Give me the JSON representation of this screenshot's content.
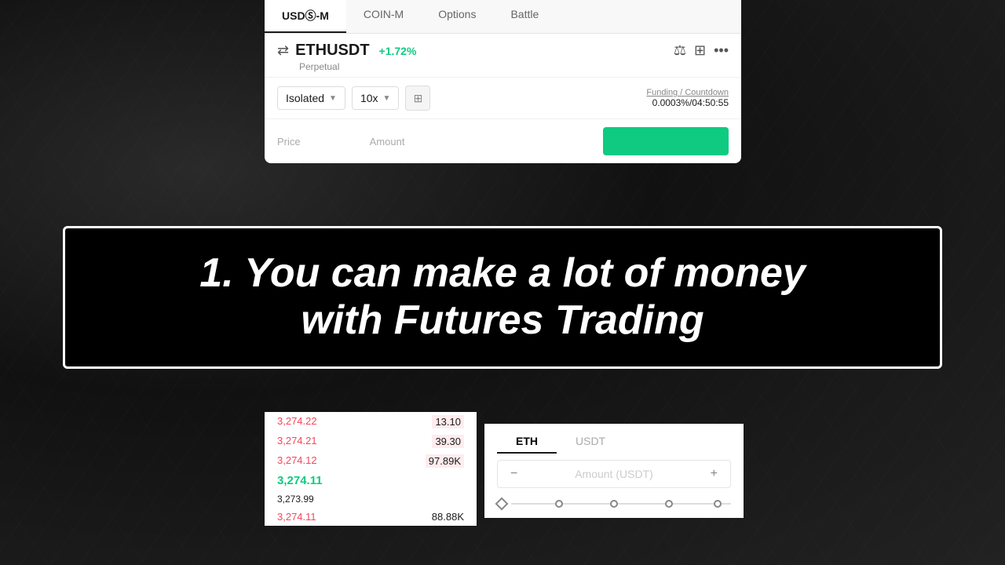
{
  "tabs": {
    "items": [
      {
        "label": "USDⓈ-M",
        "active": true
      },
      {
        "label": "COIN-M",
        "active": false
      },
      {
        "label": "Options",
        "active": false
      },
      {
        "label": "Battle",
        "active": false
      }
    ]
  },
  "header": {
    "pair": "ETHUSDT",
    "change": "+1.72%",
    "subtitle": "Perpetual"
  },
  "controls": {
    "margin_mode": "Isolated",
    "leverage": "10x",
    "funding_label": "Funding / Countdown",
    "funding_value": "0.0003%/04:50:55"
  },
  "order_form": {
    "price_label": "Price",
    "amount_label": "Amount",
    "amount_placeholder": "Amount (USDT)"
  },
  "order_book": {
    "rows": [
      {
        "price": "3,274.22",
        "volume": "13.10",
        "vol_highlight": true
      },
      {
        "price": "3,274.21",
        "volume": "39.30",
        "vol_highlight": true
      },
      {
        "price": "3,274.12",
        "volume": "97.89K",
        "vol_highlight": true
      },
      {
        "price": "3,274.11",
        "is_mid": true,
        "volume": ""
      },
      {
        "price": "3,273.99",
        "is_sub": true,
        "volume": ""
      },
      {
        "price": "3,274.11",
        "volume": "88.88K",
        "vol_highlight": false
      }
    ],
    "mid_price": "3,274.11",
    "sub_price": "3,273.99"
  },
  "asset_tabs": {
    "eth": "ETH",
    "usdt": "USDT"
  },
  "overlay": {
    "line1": "1. You can make a lot of money",
    "line2": "with Futures Trading"
  }
}
